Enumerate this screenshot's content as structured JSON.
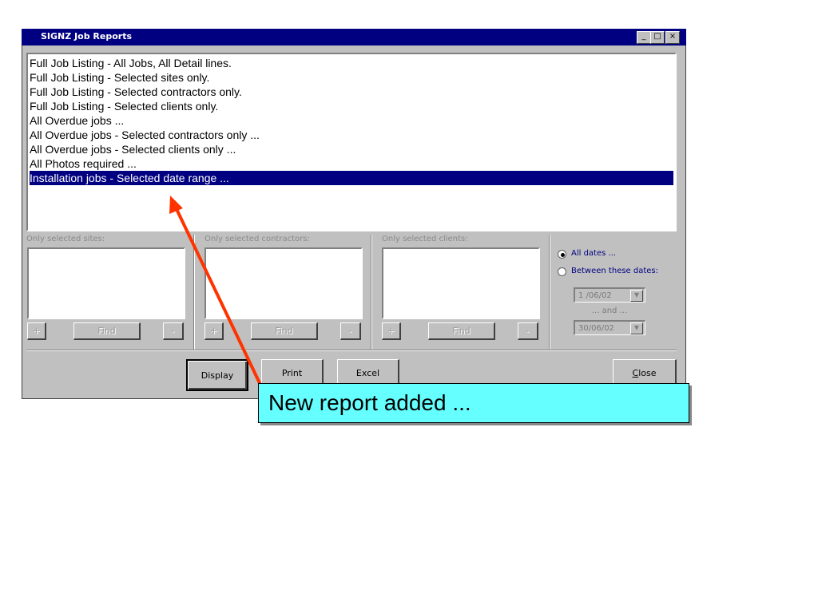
{
  "window": {
    "title": "SIGNZ Job Reports",
    "controls": {
      "minimize": "_",
      "maximize": "□",
      "close": "×"
    }
  },
  "reports": [
    "Full Job Listing - All Jobs, All Detail lines.",
    "Full Job Listing - Selected sites only.",
    "Full Job Listing - Selected contractors only.",
    "Full Job Listing - Selected clients only.",
    "All Overdue jobs ...",
    "All Overdue jobs - Selected contractors only ...",
    "All Overdue jobs - Selected clients only ...",
    "All Photos required ...",
    "Installation jobs - Selected date range ..."
  ],
  "selected_report_index": 8,
  "filters": {
    "sites": {
      "label": "Only selected sites:",
      "add": "+",
      "find": "Find",
      "remove": "-"
    },
    "contractors": {
      "label": "Only selected contractors:",
      "add": "+",
      "find": "Find",
      "remove": "-"
    },
    "clients": {
      "label": "Only selected clients:",
      "add": "+",
      "find": "Find",
      "remove": "-"
    }
  },
  "dates": {
    "all_dates_label": "All dates ...",
    "between_label": "Between these dates:",
    "selected": "all",
    "from": "1 /06/02",
    "and_label": "... and ...",
    "to": "30/06/02",
    "dropdown_glyph": "▼"
  },
  "actions": {
    "display": "Display",
    "print": "Print",
    "excel": "Excel",
    "close": "Close"
  },
  "annotation": {
    "callout": "New report added ...",
    "arrow_color": "#ff3300",
    "callout_color": "#66ffff"
  },
  "colors": {
    "titlebar": "#000080",
    "selection": "#000080",
    "window": "#c0c0c0"
  }
}
